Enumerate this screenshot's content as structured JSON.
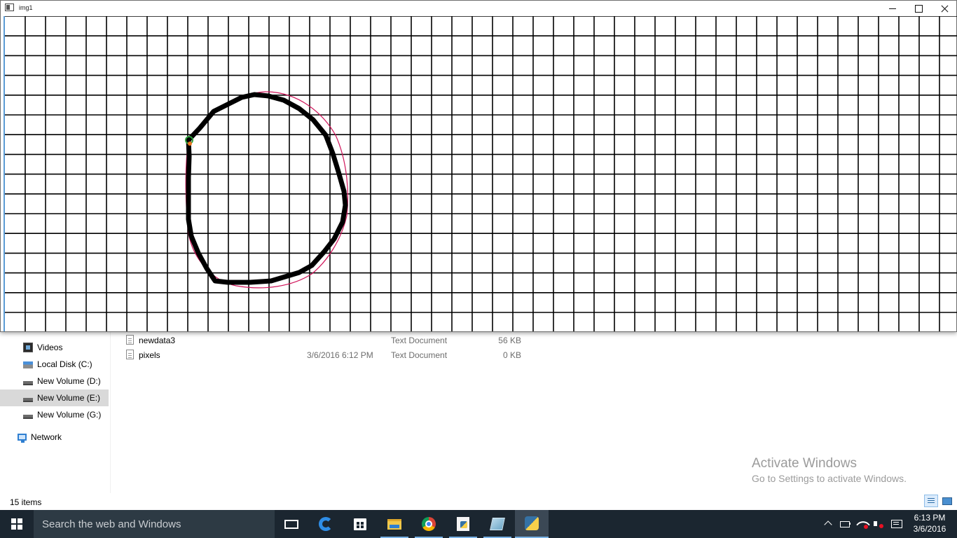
{
  "explorer": {
    "nav_items": [
      {
        "label": "Videos",
        "icon": "videos-icon"
      },
      {
        "label": "Local Disk (C:)",
        "icon": "local-disk-icon"
      },
      {
        "label": "New Volume (D:)",
        "icon": "drive-icon"
      },
      {
        "label": "New Volume (E:)",
        "icon": "drive-icon",
        "selected": true
      },
      {
        "label": "New Volume (G:)",
        "icon": "drive-icon"
      },
      {
        "label": "Network",
        "icon": "network-icon"
      }
    ],
    "files": [
      {
        "name": "newdata3",
        "date": "",
        "type": "Text Document",
        "size": "56 KB"
      },
      {
        "name": "pixels",
        "date": "3/6/2016 6:12 PM",
        "type": "Text Document",
        "size": "0 KB"
      }
    ],
    "status": {
      "item_count": "15 items"
    },
    "watermark": {
      "title": "Activate Windows",
      "subtitle": "Go to Settings to activate Windows."
    }
  },
  "img_window": {
    "title": "img1",
    "grid_color": "#000000",
    "stroke_color": "#000000",
    "outline_color": "#d0145a",
    "start_point_color": "#e87722",
    "start_ring_color": "#2e9e3c"
  },
  "taskbar": {
    "search_placeholder": "Search the web and Windows",
    "apps": [
      "task-view-icon",
      "edge-icon",
      "store-icon",
      "file-explorer-icon",
      "chrome-icon",
      "python-file-icon",
      "notepad-icon",
      "python-icon"
    ],
    "clock": {
      "time": "6:13 PM",
      "date": "3/6/2016"
    },
    "accent_color": "#7ab3e6",
    "background_color": "#1b2630"
  }
}
